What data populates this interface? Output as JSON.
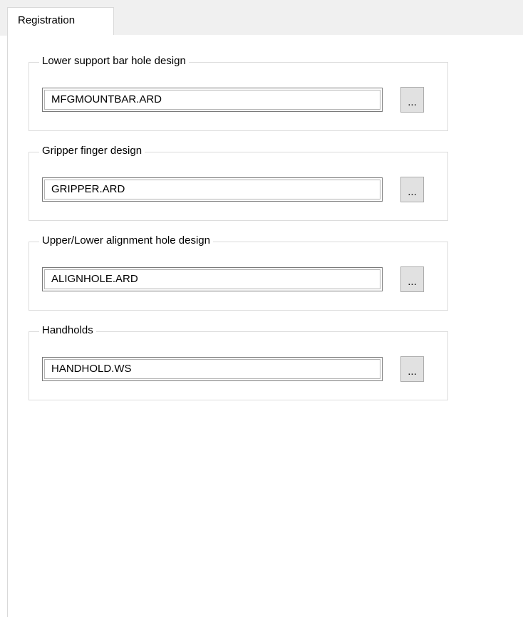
{
  "tabs": [
    {
      "label": "Registration",
      "active": true
    }
  ],
  "groups": [
    {
      "title": "Lower support bar hole design",
      "value": "MFGMOUNTBAR.ARD",
      "browse_label": "..."
    },
    {
      "title": "Gripper finger design",
      "value": "GRIPPER.ARD",
      "browse_label": "..."
    },
    {
      "title": "Upper/Lower alignment hole design",
      "value": "ALIGNHOLE.ARD",
      "browse_label": "..."
    },
    {
      "title": "Handholds",
      "value": "HANDHOLD.WS",
      "browse_label": "..."
    }
  ],
  "colors": {
    "tab_strip_bg": "#f0f0f0",
    "border": "#d9d9d9",
    "button_bg": "#e1e1e1"
  }
}
